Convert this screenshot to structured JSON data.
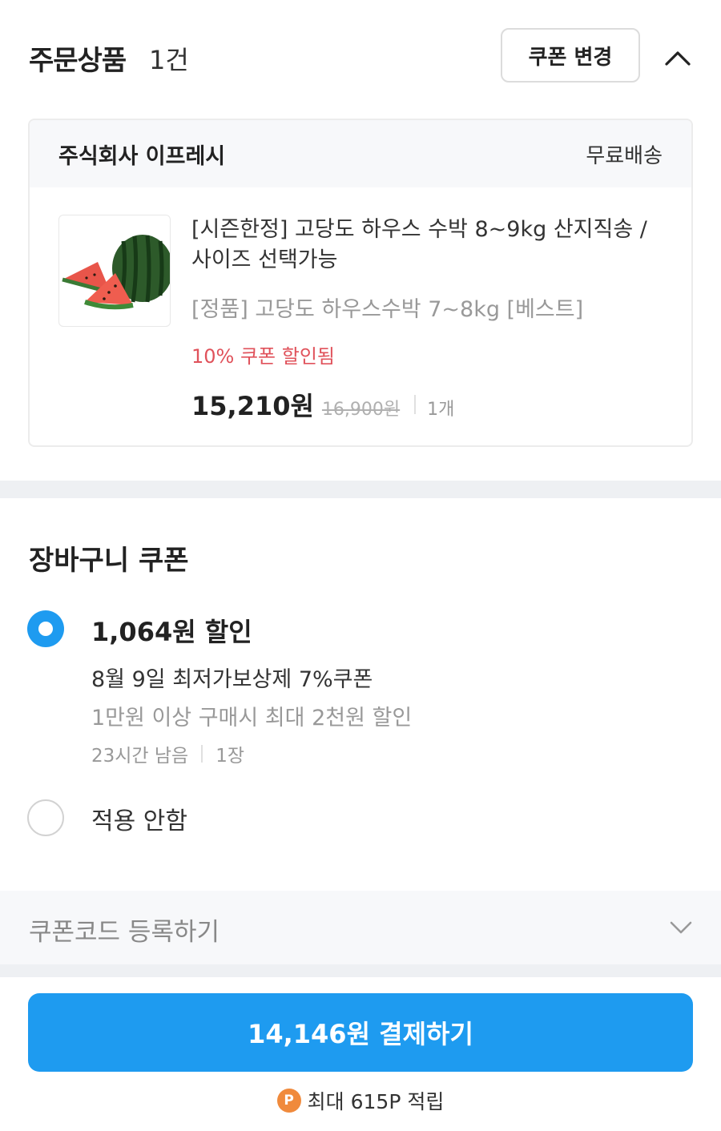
{
  "order": {
    "title": "주문상품",
    "count": "1건",
    "coupon_change_label": "쿠폰 변경",
    "collapse_icon": "chevron-up-icon"
  },
  "product_card": {
    "seller": "주식회사 이프레시",
    "shipping": "무료배송",
    "thumbnail_icon": "watermelon-image",
    "name": "[시즌한정] 고당도 하우스 수박 8~9kg 산지직송 / 사이즈 선택가능",
    "option": "[정품] 고당도 하우스수박 7~8kg [베스트]",
    "discount_note": "10% 쿠폰 할인됨",
    "price": "15,210원",
    "original_price": "16,900원",
    "quantity": "1개"
  },
  "cart_coupon": {
    "title": "장바구니 쿠폰",
    "options": [
      {
        "amount": "1,064원 할인",
        "name": "8월 9일 최저가보상제 7%쿠폰",
        "condition": "1만원 이상 구매시 최대 2천원 할인",
        "time_left": "23시간 남음",
        "count": "1장",
        "selected": true
      },
      {
        "label": "적용 안함",
        "selected": false
      }
    ]
  },
  "coupon_code": {
    "label": "쿠폰코드 등록하기",
    "icon": "chevron-down-icon"
  },
  "payment": {
    "button_label": "14,146원 결제하기",
    "points_icon_letter": "P",
    "points_text": "최대 615P 적립"
  },
  "colors": {
    "accent": "#1e9bf0",
    "discount": "#e0525b",
    "points": "#f08a3c"
  }
}
